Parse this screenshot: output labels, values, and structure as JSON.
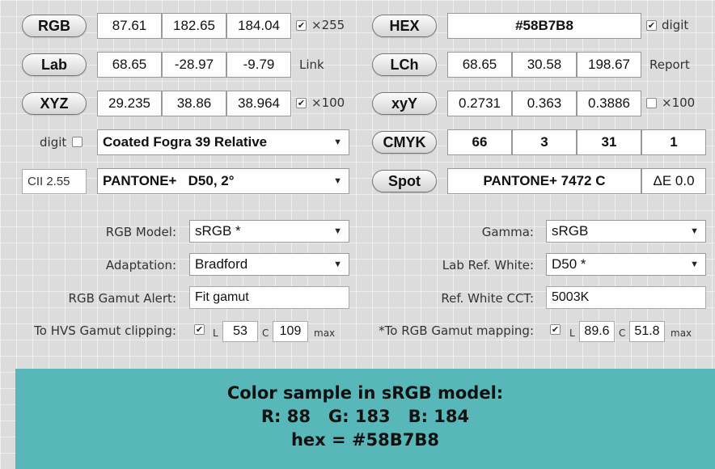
{
  "colors": {
    "sample_bg": "#58B7B8"
  },
  "rows": {
    "rgb": {
      "button": "RGB",
      "values": [
        "87.61",
        "182.65",
        "184.04"
      ],
      "check_label": "×255",
      "checked": true
    },
    "lab": {
      "button": "Lab",
      "values": [
        "68.65",
        "-28.97",
        "-9.79"
      ],
      "side_label": "Link"
    },
    "xyz": {
      "button": "XYZ",
      "values": [
        "29.235",
        "38.86",
        "38.964"
      ],
      "check_label": "×100",
      "checked": true
    },
    "digit_row": {
      "label": "digit",
      "checked": false,
      "profile": "Coated Fogra 39 Relative"
    },
    "spot_row": {
      "cii": "CII 2.55",
      "library": "PANTONE+   D50, 2°"
    },
    "hex": {
      "button": "HEX",
      "value": "#58B7B8",
      "check_label": "digit",
      "checked": true
    },
    "lch": {
      "button": "LCh",
      "values": [
        "68.65",
        "30.58",
        "198.67"
      ],
      "side_label": "Report"
    },
    "xyy": {
      "button": "xyY",
      "values": [
        "0.2731",
        "0.363",
        "0.3886"
      ],
      "check_label": "×100",
      "checked": false
    },
    "cmyk": {
      "button": "CMYK",
      "values": [
        "66",
        "3",
        "31",
        "1"
      ]
    },
    "spot": {
      "button": "Spot",
      "value": "PANTONE+ 7472 C",
      "delta": "ΔE 0.0"
    }
  },
  "settings": {
    "rgb_model": {
      "label": "RGB Model:",
      "value": "sRGB *"
    },
    "adaptation": {
      "label": "Adaptation:",
      "value": "Bradford"
    },
    "gamut_alert": {
      "label": "RGB Gamut Alert:",
      "value": "Fit gamut"
    },
    "hvs": {
      "label": "To HVS Gamut clipping:",
      "checked": true,
      "l_label": "L",
      "l_value": "53",
      "c_label": "C",
      "c_value": "109",
      "max": "max"
    },
    "gamma": {
      "label": "Gamma:",
      "value": "sRGB"
    },
    "lab_white": {
      "label": "Lab Ref. White:",
      "value": "D50 *"
    },
    "cct": {
      "label": "Ref. White CCT:",
      "value": "5003K"
    },
    "rgb_mapping": {
      "label": "*To RGB Gamut mapping:",
      "checked": true,
      "l_label": "L",
      "l_value": "89.6",
      "c_label": "C",
      "c_value": "51.8",
      "max": "max"
    }
  },
  "sample": {
    "line1": "Color sample in sRGB model:",
    "line2": "R: 88   G: 183   B: 184",
    "line3": "hex = #58B7B8"
  }
}
